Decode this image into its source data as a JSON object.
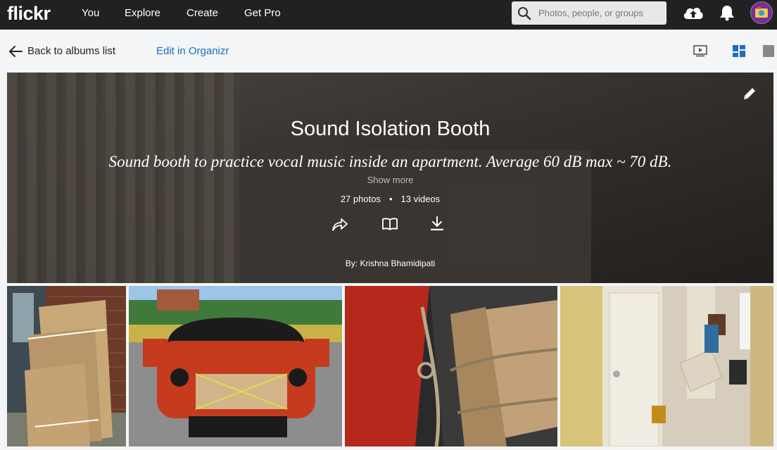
{
  "nav": {
    "logo": "flickr",
    "items": [
      "You",
      "Explore",
      "Create",
      "Get Pro"
    ],
    "search_placeholder": "Photos, people, or groups",
    "icons": [
      "search-icon",
      "upload-cloud-icon",
      "bell-icon",
      "avatar"
    ]
  },
  "subnav": {
    "back_label": "Back to albums list",
    "edit_label": "Edit in Organizr",
    "view_icons": [
      "slideshow-icon",
      "grid-icon",
      "single-view-icon"
    ]
  },
  "album": {
    "title": "Sound Isolation Booth",
    "description": "Sound booth to practice vocal music inside an apartment. Average 60 dB max ~ 70 dB.",
    "show_more": "Show more",
    "photos_count": "27 photos",
    "videos_count": "13 videos",
    "byline": "By: Krishna Bhamidipati",
    "actions": [
      "share-icon",
      "book-icon",
      "download-icon"
    ]
  },
  "photos": [
    {
      "name": "photo-boxes-against-wall"
    },
    {
      "name": "photo-car-with-box"
    },
    {
      "name": "photo-box-in-car-interior"
    },
    {
      "name": "photo-apartment-doorway"
    }
  ],
  "colors": {
    "nav_bg": "#212124",
    "link_blue": "#1a6fbd",
    "active_view": "#1a6fbd"
  }
}
